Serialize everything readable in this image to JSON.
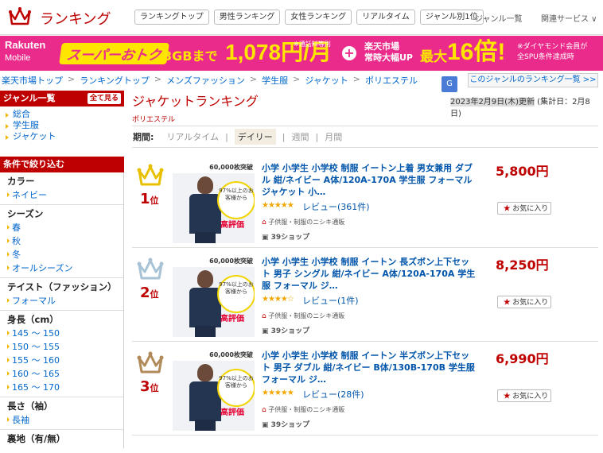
{
  "header": {
    "logo_text": "ランキング",
    "nav": [
      "ランキングトップ",
      "男性ランキング",
      "女性ランキング",
      "リアルタイム",
      "ジャンル別1位"
    ],
    "genre_list": "ジャンル一覧",
    "related_services": "関連サービス ∨"
  },
  "banner": {
    "brand": "Rakuten",
    "brand_sub": "Mobile",
    "super": "スーパーおトク",
    "gb": "3GBまで",
    "price": "1,078円/月",
    "note1": "※通話料等別",
    "plus": "+",
    "ichiba_line1": "楽天市場",
    "ichiba_line2": "常時大幅UP",
    "max": "最大",
    "bai": "16倍!",
    "note2_line1": "※ダイヤモンド会員が",
    "note2_line2": "全SPU条件達成時"
  },
  "breadcrumb": [
    "楽天市場トップ",
    "ランキングトップ",
    "メンズファッション",
    "学生服",
    "ジャケット",
    "ポリエステル"
  ],
  "genre_ranking_link": "このジャンルのランキング一覧 >>",
  "sidebar": {
    "genre_title": "ジャンル一覧",
    "show_all": "全て見る",
    "genres": [
      "総合",
      "学生服",
      "ジャケット"
    ],
    "filter_title": "条件で絞り込む",
    "filters": [
      {
        "title": "カラー",
        "options": [
          "ネイビー"
        ]
      },
      {
        "title": "シーズン",
        "options": [
          "春",
          "秋",
          "冬",
          "オールシーズン"
        ]
      },
      {
        "title": "テイスト（ファッション）",
        "options": [
          "フォーマル"
        ]
      },
      {
        "title": "身長（cm）",
        "options": [
          "145 ～ 150",
          "150 ～ 155",
          "155 ～ 160",
          "160 ～ 165",
          "165 ～ 170"
        ]
      },
      {
        "title": "長さ（袖）",
        "options": [
          "長袖"
        ]
      },
      {
        "title": "裏地（有/無）",
        "options": []
      }
    ]
  },
  "main": {
    "title": "ジャケットランキング",
    "subgenre": "ポリエステル",
    "updated_date": "2023年2月9日(木)更新",
    "updated_tally": "(集計日：2月8日)",
    "period_label": "期間:",
    "tabs": [
      "リアルタイム",
      "デイリー",
      "週間",
      "月間"
    ],
    "active_tab": "デイリー"
  },
  "items": [
    {
      "rank": "1",
      "rank_suffix": "位",
      "title": "小学 小学生 小学校 制服 イートン上着 男女兼用 ダブル 紺/ネイビー A体/120A-170A 学生服 フォーマル ジャケット 小…",
      "stars": "★★★★★",
      "review": "レビュー(361件)",
      "shop_badge": "子供服・制服のニシキ通販",
      "shop_name": "39ショップ",
      "price": "5,800円",
      "fav": "お気に入り",
      "thumb_top": "60,000枚突破",
      "thumb_circle": "97%以上のお客様から",
      "thumb_eval": "高評価",
      "crown_color": "#e8c000"
    },
    {
      "rank": "2",
      "rank_suffix": "位",
      "title": "小学 小学生 小学校 制服 イートン 長ズボン上下セット 男子 シングル 紺/ネイビー A体/120A-170A 学生服 フォーマル ジ…",
      "stars": "★★★★☆",
      "review": "レビュー(1件)",
      "shop_badge": "子供服・制服のニシキ通販",
      "shop_name": "39ショップ",
      "price": "8,250円",
      "fav": "お気に入り",
      "thumb_top": "60,000枚突破",
      "thumb_circle": "97%以上のお客様から",
      "thumb_eval": "高評価",
      "crown_color": "#a9c3d6"
    },
    {
      "rank": "3",
      "rank_suffix": "位",
      "title": "小学 小学生 小学校 制服 イートン 半ズボン上下セット 男子 ダブル 紺/ネイビー B体/130B-170B 学生服 フォーマル ジ…",
      "stars": "★★★★★",
      "review": "レビュー(28件)",
      "shop_badge": "子供服・制服のニシキ通販",
      "shop_name": "39ショップ",
      "price": "6,990円",
      "fav": "お気に入り",
      "thumb_top": "60,000枚突破",
      "thumb_circle": "97%以上のお客様から",
      "thumb_eval": "高評価",
      "crown_color": "#b08a58"
    }
  ]
}
